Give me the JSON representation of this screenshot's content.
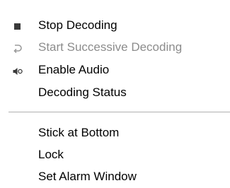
{
  "menu": {
    "items": [
      {
        "label": "Stop Decoding",
        "icon": "stop-icon",
        "disabled": false
      },
      {
        "label": "Start Successive Decoding",
        "icon": "repeat-icon",
        "disabled": true
      },
      {
        "label": "Enable Audio",
        "icon": "speaker-muted-icon",
        "disabled": false
      },
      {
        "label": "Decoding Status",
        "icon": "",
        "disabled": false
      },
      {
        "label": "Stick at Bottom",
        "icon": "",
        "disabled": false
      },
      {
        "label": "Lock",
        "icon": "",
        "disabled": false
      },
      {
        "label": "Set Alarm Window",
        "icon": "",
        "disabled": false
      }
    ]
  },
  "colors": {
    "text": "#000000",
    "disabled_text": "#8c8c8c",
    "separator": "#b0b0b0",
    "background": "#ffffff"
  }
}
